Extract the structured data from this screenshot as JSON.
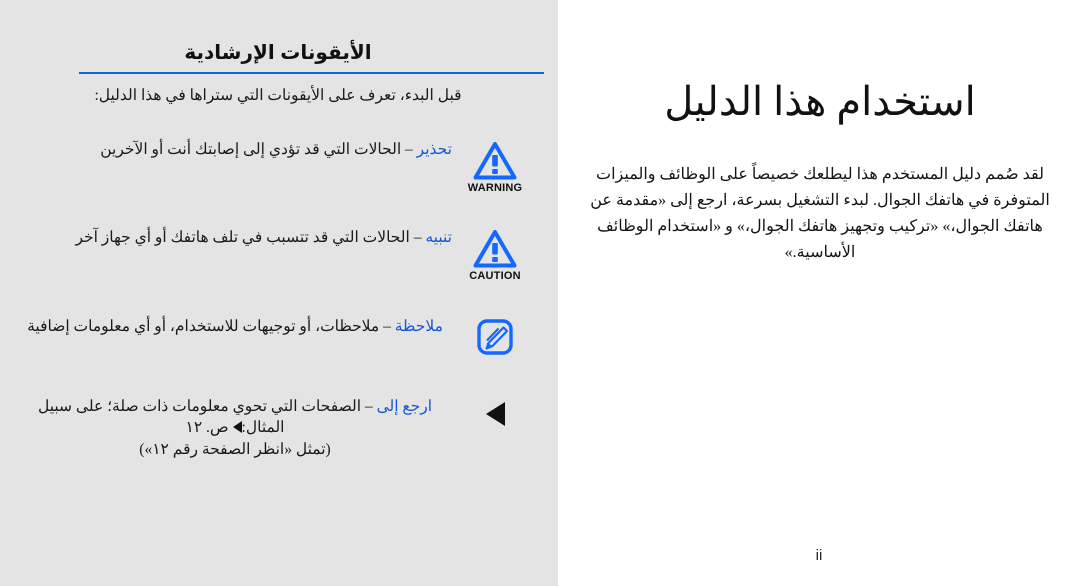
{
  "left_panel": {
    "heading": "الأيقونات الإرشادية",
    "intro": "قبل البدء، تعرف على الأيقونات التي ستراها في هذا الدليل:",
    "accent_color": "#0a66d4",
    "keyword_color": "#1356d8",
    "background_color": "#e4e4e4",
    "rows": [
      {
        "icon": "warning-triangle-icon",
        "icon_caption": "WARNING",
        "keyword": "تحذير",
        "description": " – الحالات التي قد تؤدي إلى إصابتك أنت أو الآخرين"
      },
      {
        "icon": "caution-triangle-icon",
        "icon_caption": "CAUTION",
        "keyword": "تنبيه",
        "description": " – الحالات التي قد تتسبب في تلف هاتفك أو أي جهاز آخر"
      },
      {
        "icon": "note-pencil-icon",
        "icon_caption": "",
        "keyword": "ملاحظة",
        "description": " – ملاحظات، أو توجيهات للاستخدام، أو أي معلومات إضافية"
      },
      {
        "icon": "refer-to-arrow-icon",
        "icon_caption": "",
        "keyword": "ارجع إلى",
        "description": " – الصفحات التي تحوي معلومات ذات صلة؛ على سبيل المثال:",
        "example_prefix": " ص. ١٢",
        "example_note": "(تمثل «انظر الصفحة رقم ١٢»)"
      }
    ]
  },
  "right_panel": {
    "title": "استخدام هذا الدليل",
    "body": "لقد صُمم دليل المستخدم هذا ليطلعك خصيصاً على الوظائف والميزات المتوفرة في هاتفك الجوال. لبدء التشغيل بسرعة، ارجع إلى «مقدمة عن هاتفك الجوال،» «تركيب وتجهيز هاتفك الجوال،» و «استخدام الوظائف الأساسية.»",
    "page_number": "ii",
    "background_color": "#ffffff"
  }
}
